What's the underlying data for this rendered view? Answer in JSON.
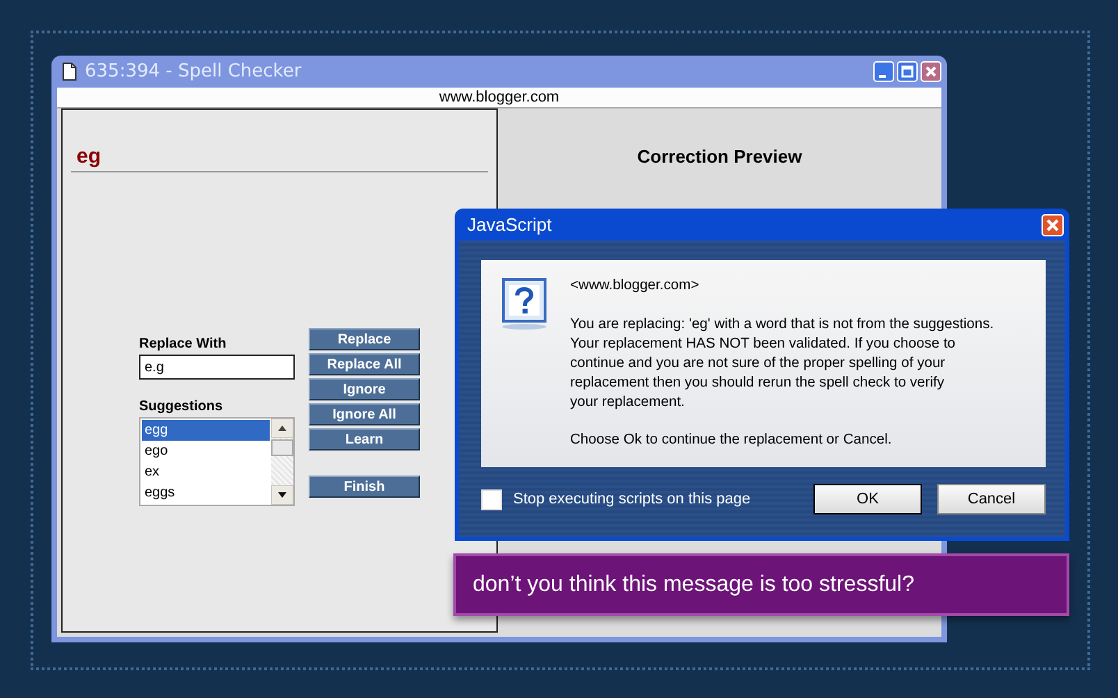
{
  "spell_window": {
    "title": "635:394 - Spell Checker",
    "url": "www.blogger.com",
    "word": "eg",
    "preview_heading": "Correction Preview",
    "replace_with": {
      "label": "Replace With",
      "value": "e.g"
    },
    "suggestions": {
      "label": "Suggestions",
      "items": [
        {
          "text": "egg",
          "selected": true
        },
        {
          "text": "ego",
          "selected": false
        },
        {
          "text": "ex",
          "selected": false
        },
        {
          "text": "eggs",
          "selected": false
        }
      ]
    },
    "buttons": [
      "Replace",
      "Replace All",
      "Ignore",
      "Ignore All",
      "Learn"
    ],
    "finish_button": "Finish"
  },
  "dialog": {
    "title": "JavaScript",
    "origin": "<www.blogger.com>",
    "message": "You are replacing: 'eg' with a word that is not from the suggestions.\nYour replacement HAS NOT been validated.  If you choose to\ncontinue and you are not sure of the proper spelling of your\nreplacement then you should rerun the spell check to verify\nyour replacement.",
    "prompt": "Choose Ok to continue the replacement or Cancel.",
    "checkbox": {
      "label": "Stop executing scripts on this page",
      "checked": false
    },
    "buttons": [
      {
        "label": "OK",
        "default": true
      },
      {
        "label": "Cancel",
        "default": false
      }
    ]
  },
  "banner": "don’t you think this message is too stressful?"
}
